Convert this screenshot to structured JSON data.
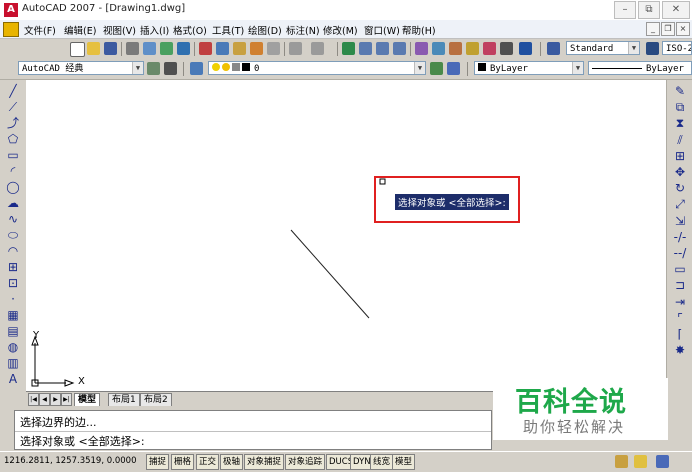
{
  "title_bar": {
    "app_icon": "A",
    "title": "AutoCAD 2007 - [Drawing1.dwg]",
    "buttons": [
      "–",
      "⧉",
      "✕"
    ]
  },
  "menu_bar": {
    "items": [
      "文件(F)",
      "编辑(E)",
      "视图(V)",
      "插入(I)",
      "格式(O)",
      "工具(T)",
      "绘图(D)",
      "标注(N)",
      "修改(M)",
      "窗口(W)",
      "帮助(H)"
    ],
    "doc_buttons": [
      "_",
      "❐",
      "×"
    ]
  },
  "toolbar_top": {
    "text_style": "Standard",
    "dim_style": "ISO-2"
  },
  "toolbar_second": {
    "workspace": "AutoCAD 经典",
    "layer": "0",
    "color": "ByLayer",
    "linetype": "ByLayer"
  },
  "tooltip": {
    "text": "选择对象或 <全部选择>:",
    "highlight_color": "#e02020"
  },
  "ucs": {
    "y_label": "Y",
    "x_label": "X"
  },
  "layout_tabs": [
    "模型",
    "布局1",
    "布局2"
  ],
  "layout_nav": [
    "|◀",
    "◀",
    "▶",
    "▶|"
  ],
  "command": {
    "line1": "选择边界的边...",
    "line2": "选择对象或 <全部选择>:"
  },
  "status_bar": {
    "coords": "1216.2811, 1257.3519, 0.0000",
    "toggles": [
      "捕捉",
      "栅格",
      "正交",
      "极轴",
      "对象捕捉",
      "对象追踪",
      "DUCS",
      "DYN",
      "线宽",
      "模型"
    ]
  },
  "watermark": {
    "title": "百科全说",
    "subtitle": "助你轻松解决",
    "color": "#1ea84a"
  },
  "left_tools": [
    "line-icon",
    "construction-line-icon",
    "polyline-icon",
    "polygon-icon",
    "rectangle-icon",
    "arc-icon",
    "circle-icon",
    "revision-cloud-icon",
    "spline-icon",
    "ellipse-icon",
    "ellipse-arc-icon",
    "insert-block-icon",
    "make-block-icon",
    "point-icon",
    "hatch-icon",
    "gradient-icon",
    "region-icon",
    "table-icon",
    "mtext-icon"
  ],
  "right_tools": [
    "erase-icon",
    "copy-icon",
    "mirror-icon",
    "offset-icon",
    "array-icon",
    "move-icon",
    "rotate-icon",
    "scale-icon",
    "stretch-icon",
    "trim-icon",
    "extend-icon",
    "break-at-point-icon",
    "break-icon",
    "join-icon",
    "chamfer-icon",
    "fillet-icon",
    "explode-icon"
  ]
}
